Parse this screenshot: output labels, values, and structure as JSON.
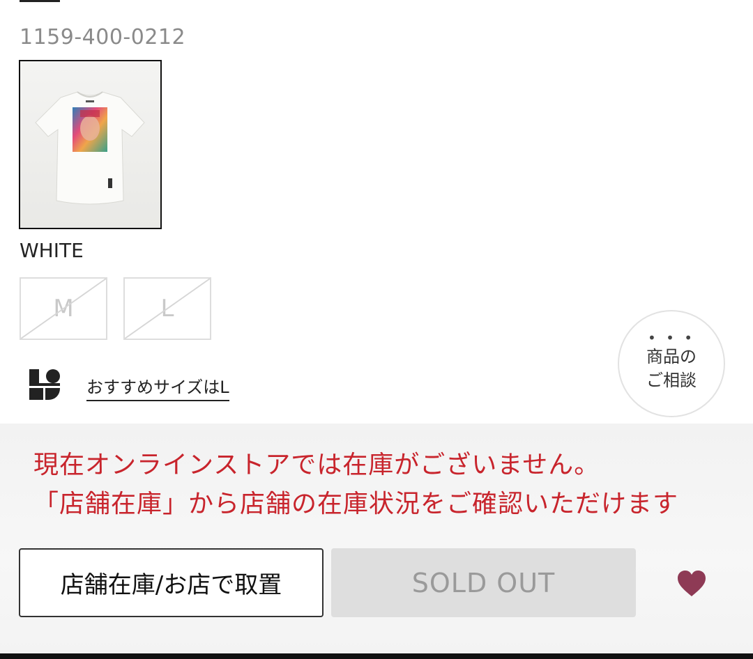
{
  "product": {
    "code": "1159-400-0212",
    "color": "WHITE",
    "sizes": [
      "M",
      "L"
    ],
    "size_availability": [
      "sold-out",
      "sold-out"
    ]
  },
  "consult": {
    "dots": "• • •",
    "label": "商品の\nご相談"
  },
  "recommend": {
    "text": "おすすめサイズはL"
  },
  "notice": {
    "text": "現在オンラインストアでは在庫がございません。\n「店舗在庫」から店舗の在庫状況をご確認いただけます"
  },
  "actions": {
    "store_button": "店舗在庫/お店で取置",
    "sold_out_button": "SOLD OUT"
  },
  "colors": {
    "notice_red": "#c8242c",
    "heart": "#8e3a55"
  },
  "icons": {
    "favorite": "heart-icon",
    "recommend_logo": "size-recommend-logo-icon"
  }
}
